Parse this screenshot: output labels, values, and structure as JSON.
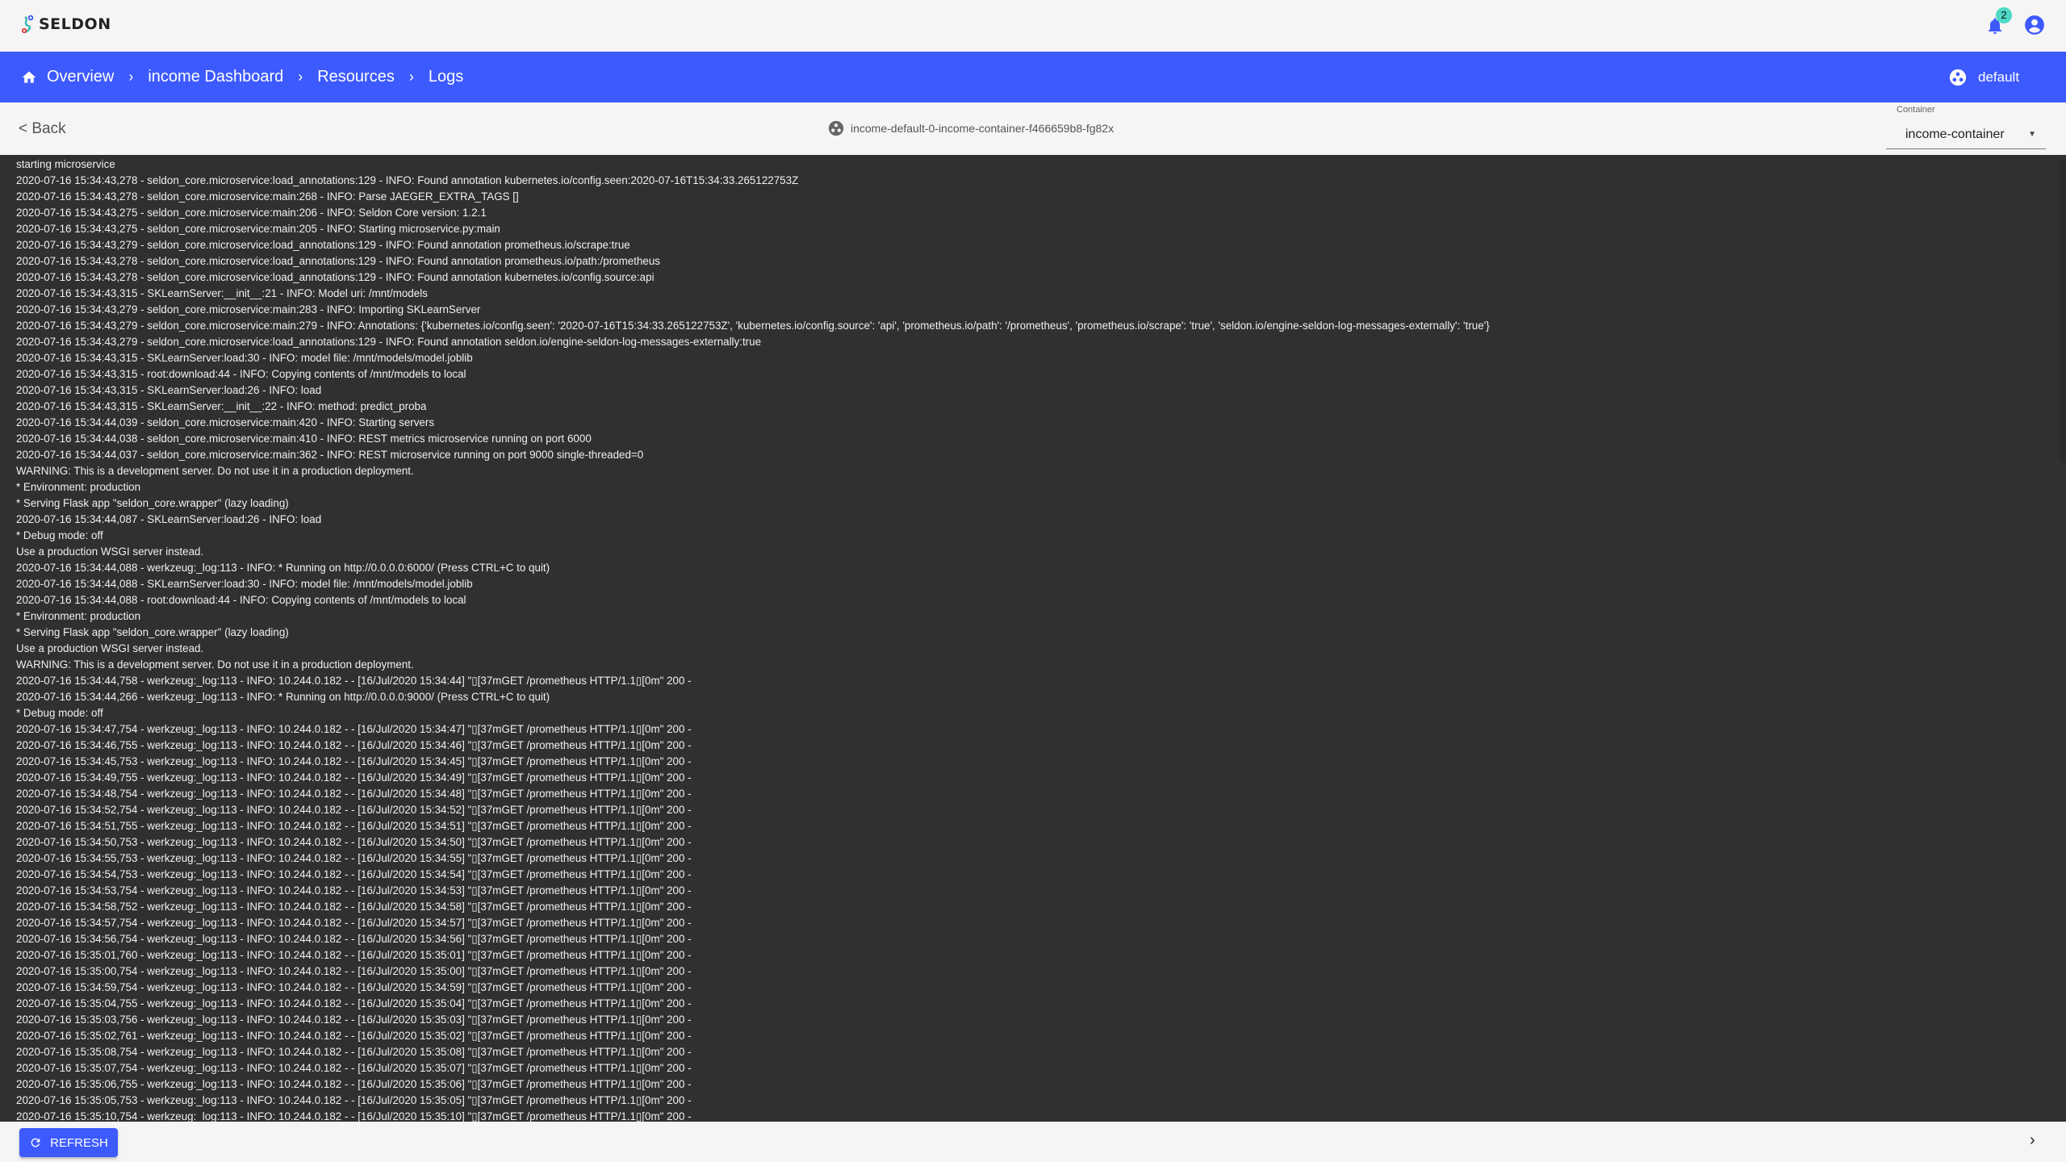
{
  "app": {
    "logo_text": "SELDON",
    "notification_count": "2",
    "accent": "#3d5afe",
    "badge_color": "#4dd9c6"
  },
  "breadcrumb": [
    "Overview",
    "income Dashboard",
    "Resources",
    "Logs"
  ],
  "namespace": "default",
  "subheader": {
    "back_label": "< Back",
    "pod_name": "income-default-0-income-container-f466659b8-fg82x",
    "container_label": "Container",
    "container_value": "income-container"
  },
  "logs": {
    "lines": [
      "starting microservice",
      "2020-07-16 15:34:43,278 - seldon_core.microservice:load_annotations:129 - INFO: Found annotation kubernetes.io/config.seen:2020-07-16T15:34:33.265122753Z",
      "2020-07-16 15:34:43,278 - seldon_core.microservice:main:268 - INFO: Parse JAEGER_EXTRA_TAGS []",
      "2020-07-16 15:34:43,275 - seldon_core.microservice:main:206 - INFO: Seldon Core version: 1.2.1",
      "2020-07-16 15:34:43,275 - seldon_core.microservice:main:205 - INFO: Starting microservice.py:main",
      "2020-07-16 15:34:43,279 - seldon_core.microservice:load_annotations:129 - INFO: Found annotation prometheus.io/scrape:true",
      "2020-07-16 15:34:43,278 - seldon_core.microservice:load_annotations:129 - INFO: Found annotation prometheus.io/path:/prometheus",
      "2020-07-16 15:34:43,278 - seldon_core.microservice:load_annotations:129 - INFO: Found annotation kubernetes.io/config.source:api",
      "2020-07-16 15:34:43,315 - SKLearnServer:__init__:21 - INFO: Model uri: /mnt/models",
      "2020-07-16 15:34:43,279 - seldon_core.microservice:main:283 - INFO: Importing SKLearnServer",
      "2020-07-16 15:34:43,279 - seldon_core.microservice:main:279 - INFO: Annotations: {'kubernetes.io/config.seen': '2020-07-16T15:34:33.265122753Z', 'kubernetes.io/config.source': 'api', 'prometheus.io/path': '/prometheus', 'prometheus.io/scrape': 'true', 'seldon.io/engine-seldon-log-messages-externally': 'true'}",
      "2020-07-16 15:34:43,279 - seldon_core.microservice:load_annotations:129 - INFO: Found annotation seldon.io/engine-seldon-log-messages-externally:true",
      "2020-07-16 15:34:43,315 - SKLearnServer:load:30 - INFO: model file: /mnt/models/model.joblib",
      "2020-07-16 15:34:43,315 - root:download:44 - INFO: Copying contents of /mnt/models to local",
      "2020-07-16 15:34:43,315 - SKLearnServer:load:26 - INFO: load",
      "2020-07-16 15:34:43,315 - SKLearnServer:__init__:22 - INFO: method: predict_proba",
      "2020-07-16 15:34:44,039 - seldon_core.microservice:main:420 - INFO: Starting servers",
      "2020-07-16 15:34:44,038 - seldon_core.microservice:main:410 - INFO: REST metrics microservice running on port 6000",
      "2020-07-16 15:34:44,037 - seldon_core.microservice:main:362 - INFO: REST microservice running on port 9000 single-threaded=0",
      "WARNING: This is a development server. Do not use it in a production deployment.",
      "* Environment: production",
      "* Serving Flask app \"seldon_core.wrapper\" (lazy loading)",
      "2020-07-16 15:34:44,087 - SKLearnServer:load:26 - INFO: load",
      "* Debug mode: off",
      "Use a production WSGI server instead.",
      "2020-07-16 15:34:44,088 - werkzeug:_log:113 - INFO: * Running on http://0.0.0.0:6000/ (Press CTRL+C to quit)",
      "2020-07-16 15:34:44,088 - SKLearnServer:load:30 - INFO: model file: /mnt/models/model.joblib",
      "2020-07-16 15:34:44,088 - root:download:44 - INFO: Copying contents of /mnt/models to local",
      "* Environment: production",
      "* Serving Flask app \"seldon_core.wrapper\" (lazy loading)",
      "Use a production WSGI server instead.",
      "WARNING: This is a development server. Do not use it in a production deployment.",
      "2020-07-16 15:34:44,758 - werkzeug:_log:113 - INFO: 10.244.0.182 - - [16/Jul/2020 15:34:44] \"▯[37mGET /prometheus HTTP/1.1▯[0m\" 200 -",
      "2020-07-16 15:34:44,266 - werkzeug:_log:113 - INFO: * Running on http://0.0.0.0:9000/ (Press CTRL+C to quit)",
      "* Debug mode: off",
      "2020-07-16 15:34:47,754 - werkzeug:_log:113 - INFO: 10.244.0.182 - - [16/Jul/2020 15:34:47] \"▯[37mGET /prometheus HTTP/1.1▯[0m\" 200 -",
      "2020-07-16 15:34:46,755 - werkzeug:_log:113 - INFO: 10.244.0.182 - - [16/Jul/2020 15:34:46] \"▯[37mGET /prometheus HTTP/1.1▯[0m\" 200 -",
      "2020-07-16 15:34:45,753 - werkzeug:_log:113 - INFO: 10.244.0.182 - - [16/Jul/2020 15:34:45] \"▯[37mGET /prometheus HTTP/1.1▯[0m\" 200 -",
      "2020-07-16 15:34:49,755 - werkzeug:_log:113 - INFO: 10.244.0.182 - - [16/Jul/2020 15:34:49] \"▯[37mGET /prometheus HTTP/1.1▯[0m\" 200 -",
      "2020-07-16 15:34:48,754 - werkzeug:_log:113 - INFO: 10.244.0.182 - - [16/Jul/2020 15:34:48] \"▯[37mGET /prometheus HTTP/1.1▯[0m\" 200 -",
      "2020-07-16 15:34:52,754 - werkzeug:_log:113 - INFO: 10.244.0.182 - - [16/Jul/2020 15:34:52] \"▯[37mGET /prometheus HTTP/1.1▯[0m\" 200 -",
      "2020-07-16 15:34:51,755 - werkzeug:_log:113 - INFO: 10.244.0.182 - - [16/Jul/2020 15:34:51] \"▯[37mGET /prometheus HTTP/1.1▯[0m\" 200 -",
      "2020-07-16 15:34:50,753 - werkzeug:_log:113 - INFO: 10.244.0.182 - - [16/Jul/2020 15:34:50] \"▯[37mGET /prometheus HTTP/1.1▯[0m\" 200 -",
      "2020-07-16 15:34:55,753 - werkzeug:_log:113 - INFO: 10.244.0.182 - - [16/Jul/2020 15:34:55] \"▯[37mGET /prometheus HTTP/1.1▯[0m\" 200 -",
      "2020-07-16 15:34:54,753 - werkzeug:_log:113 - INFO: 10.244.0.182 - - [16/Jul/2020 15:34:54] \"▯[37mGET /prometheus HTTP/1.1▯[0m\" 200 -",
      "2020-07-16 15:34:53,754 - werkzeug:_log:113 - INFO: 10.244.0.182 - - [16/Jul/2020 15:34:53] \"▯[37mGET /prometheus HTTP/1.1▯[0m\" 200 -",
      "2020-07-16 15:34:58,752 - werkzeug:_log:113 - INFO: 10.244.0.182 - - [16/Jul/2020 15:34:58] \"▯[37mGET /prometheus HTTP/1.1▯[0m\" 200 -",
      "2020-07-16 15:34:57,754 - werkzeug:_log:113 - INFO: 10.244.0.182 - - [16/Jul/2020 15:34:57] \"▯[37mGET /prometheus HTTP/1.1▯[0m\" 200 -",
      "2020-07-16 15:34:56,754 - werkzeug:_log:113 - INFO: 10.244.0.182 - - [16/Jul/2020 15:34:56] \"▯[37mGET /prometheus HTTP/1.1▯[0m\" 200 -",
      "2020-07-16 15:35:01,760 - werkzeug:_log:113 - INFO: 10.244.0.182 - - [16/Jul/2020 15:35:01] \"▯[37mGET /prometheus HTTP/1.1▯[0m\" 200 -",
      "2020-07-16 15:35:00,754 - werkzeug:_log:113 - INFO: 10.244.0.182 - - [16/Jul/2020 15:35:00] \"▯[37mGET /prometheus HTTP/1.1▯[0m\" 200 -",
      "2020-07-16 15:34:59,754 - werkzeug:_log:113 - INFO: 10.244.0.182 - - [16/Jul/2020 15:34:59] \"▯[37mGET /prometheus HTTP/1.1▯[0m\" 200 -",
      "2020-07-16 15:35:04,755 - werkzeug:_log:113 - INFO: 10.244.0.182 - - [16/Jul/2020 15:35:04] \"▯[37mGET /prometheus HTTP/1.1▯[0m\" 200 -",
      "2020-07-16 15:35:03,756 - werkzeug:_log:113 - INFO: 10.244.0.182 - - [16/Jul/2020 15:35:03] \"▯[37mGET /prometheus HTTP/1.1▯[0m\" 200 -",
      "2020-07-16 15:35:02,761 - werkzeug:_log:113 - INFO: 10.244.0.182 - - [16/Jul/2020 15:35:02] \"▯[37mGET /prometheus HTTP/1.1▯[0m\" 200 -",
      "2020-07-16 15:35:08,754 - werkzeug:_log:113 - INFO: 10.244.0.182 - - [16/Jul/2020 15:35:08] \"▯[37mGET /prometheus HTTP/1.1▯[0m\" 200 -",
      "2020-07-16 15:35:07,754 - werkzeug:_log:113 - INFO: 10.244.0.182 - - [16/Jul/2020 15:35:07] \"▯[37mGET /prometheus HTTP/1.1▯[0m\" 200 -",
      "2020-07-16 15:35:06,755 - werkzeug:_log:113 - INFO: 10.244.0.182 - - [16/Jul/2020 15:35:06] \"▯[37mGET /prometheus HTTP/1.1▯[0m\" 200 -",
      "2020-07-16 15:35:05,753 - werkzeug:_log:113 - INFO: 10.244.0.182 - - [16/Jul/2020 15:35:05] \"▯[37mGET /prometheus HTTP/1.1▯[0m\" 200 -",
      "2020-07-16 15:35:10,754 - werkzeug:_log:113 - INFO: 10.244.0.182 - - [16/Jul/2020 15:35:10] \"▯[37mGET /prometheus HTTP/1.1▯[0m\" 200 -"
    ]
  },
  "footer": {
    "refresh_label": "REFRESH"
  },
  "icons": [
    "seldon-logo",
    "bell-icon",
    "account-icon",
    "home-icon",
    "chevron-right-icon",
    "namespace-icon",
    "pod-icon",
    "dropdown-arrow-icon",
    "refresh-icon",
    "chevron-right-icon"
  ]
}
